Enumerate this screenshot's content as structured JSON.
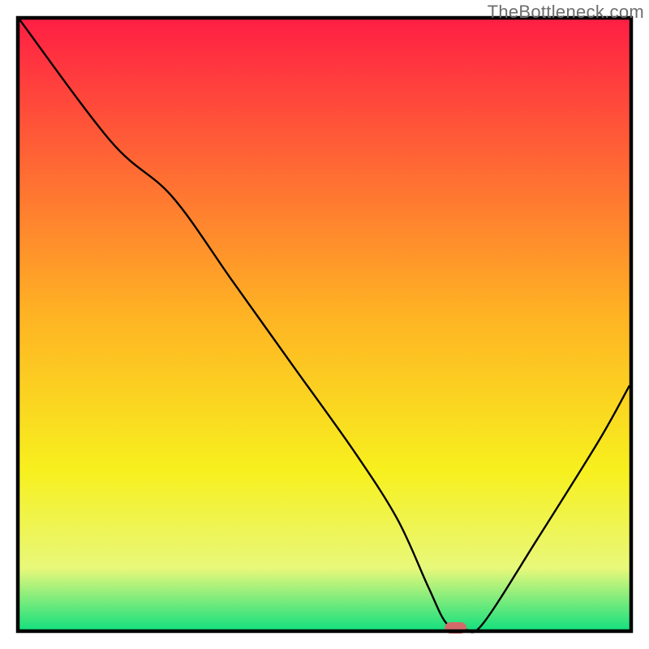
{
  "watermark": "TheBottleneck.com",
  "colors": {
    "frame": "#000000",
    "gradient_top": "#ff1f44",
    "gradient_mid1": "#ffb224",
    "gradient_mid2": "#f7f01e",
    "gradient_mid3": "#e8f87a",
    "gradient_bottom": "#16e07e",
    "curve": "#000000",
    "marker_fill": "#d46a6a",
    "marker_stroke": "#d46a6a"
  },
  "chart_data": {
    "type": "line",
    "title": "",
    "xlabel": "",
    "ylabel": "",
    "xlim": [
      0,
      100
    ],
    "ylim": [
      0,
      100
    ],
    "grid": false,
    "legend": false,
    "series": [
      {
        "name": "bottleneck-curve",
        "x": [
          0,
          15,
          25,
          35,
          45,
          55,
          62,
          67,
          70,
          73,
          76,
          85,
          95,
          100
        ],
        "values": [
          100,
          80,
          71,
          57,
          43,
          29,
          18,
          7,
          1,
          0,
          1,
          15,
          31,
          40
        ]
      }
    ],
    "annotations": [
      {
        "name": "optimal-marker",
        "x": 71.5,
        "y": 0
      }
    ],
    "background_gradient": {
      "direction": "vertical",
      "stops": [
        {
          "pos": 0.0,
          "color": "#ff1f44"
        },
        {
          "pos": 0.48,
          "color": "#ffb224"
        },
        {
          "pos": 0.74,
          "color": "#f7f01e"
        },
        {
          "pos": 0.9,
          "color": "#e8f87a"
        },
        {
          "pos": 1.0,
          "color": "#16e07e"
        }
      ]
    }
  }
}
